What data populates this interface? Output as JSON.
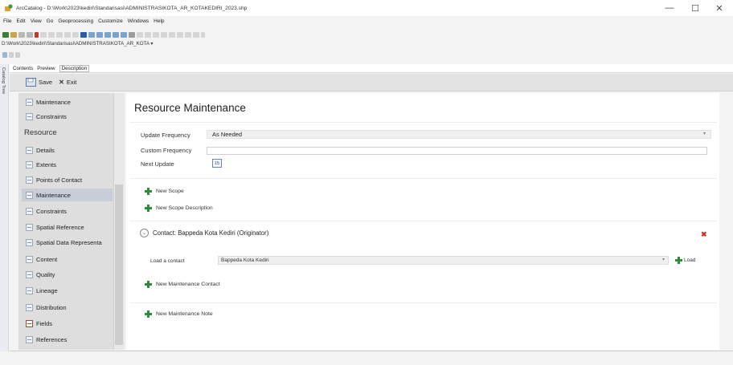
{
  "window": {
    "title": "ArcCatalog - D:\\Work\\2023\\kediri\\Standarisasi\\ADMINISTRASIKOTA_AR_KOTAKEDIRI_2023.shp",
    "minimize": "—",
    "maximize": "☐",
    "close": "✕"
  },
  "menu": [
    "File",
    "Edit",
    "View",
    "Go",
    "Geoprocessing",
    "Customize",
    "Windows",
    "Help"
  ],
  "location_path": "D:\\Work\\2023\\kediri\\Standarisasi\\ADMINISTRASIKOTA_AR_KOTA",
  "side_panel_label": "Catalog Tree",
  "tabs": [
    "Contents",
    "Preview",
    "Description"
  ],
  "actions": {
    "save": "Save",
    "exit": "Exit"
  },
  "sidebar": {
    "top_items": [
      "Maintenance",
      "Constraints"
    ],
    "section_header": "Resource",
    "items": [
      {
        "label": "Details",
        "icon": "document-icon"
      },
      {
        "label": "Extents",
        "icon": "document-icon"
      },
      {
        "label": "Points of Contact",
        "icon": "document-icon"
      },
      {
        "label": "Maintenance",
        "icon": "document-icon",
        "selected": true
      },
      {
        "label": "Constraints",
        "icon": "document-icon"
      },
      {
        "label": "Spatial Reference",
        "icon": "document-icon"
      },
      {
        "label": "Spatial Data Representa",
        "icon": "document-icon"
      },
      {
        "label": "Content",
        "icon": "document-icon"
      },
      {
        "label": "Quality",
        "icon": "document-icon"
      },
      {
        "label": "Lineage",
        "icon": "document-icon"
      },
      {
        "label": "Distribution",
        "icon": "document-icon"
      },
      {
        "label": "Fields",
        "icon": "error-icon"
      },
      {
        "label": "References",
        "icon": "document-icon"
      }
    ]
  },
  "main": {
    "title": "Resource Maintenance",
    "update_frequency_label": "Update Frequency",
    "update_frequency_value": "As Needed",
    "custom_frequency_label": "Custom Frequency",
    "custom_frequency_value": "",
    "next_update_label": "Next Update",
    "calendar_text": "15",
    "new_scope": "New Scope",
    "new_scope_description": "New Scope Description",
    "contact_label": "Contact: Bappeda Kota Kediri (Originator)",
    "load_contact_label": "Load a contact",
    "load_contact_value": "Bappeda Kota Kediri",
    "load_button": "Load",
    "new_maintenance_contact": "New Maintenance Contact",
    "new_maintenance_note": "New Maintenance Note"
  },
  "colors": {
    "accent_green": "#2e8b3b",
    "delete_red": "#c0392b",
    "selection": "#c9ced6"
  }
}
